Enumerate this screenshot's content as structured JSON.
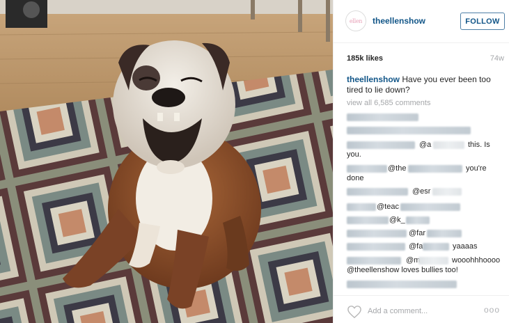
{
  "header": {
    "avatar_text": "ellen",
    "username": "theellenshow",
    "follow_label": "FOLLOW"
  },
  "stats": {
    "likes": "185k likes",
    "age": "74w"
  },
  "caption": {
    "username": "theellenshow",
    "text": "Have you ever been too tired to lie down?"
  },
  "view_all": "view all 6,585 comments",
  "comments": {
    "c3_a": "@a",
    "c3_b": "this. Is",
    "c3_c": "you.",
    "c4_a": "@the",
    "c4_b": "you're",
    "c4_c": "done",
    "c5_a": "@esr",
    "c6_a": "@teac",
    "c7_a": "@k_",
    "c8_a": "@far",
    "c9_a": "@fa",
    "c9_b": "yaaaas",
    "c10_a": "@m",
    "c10_b": "wooohhhoooo",
    "c10_c": "@theellenshow loves bullies too!"
  },
  "footer": {
    "add_comment": "Add a comment...",
    "more": "ooo"
  },
  "colors": {
    "link": "#125688",
    "muted": "#a5a7aa",
    "follow_border": "#4e7fa6"
  }
}
